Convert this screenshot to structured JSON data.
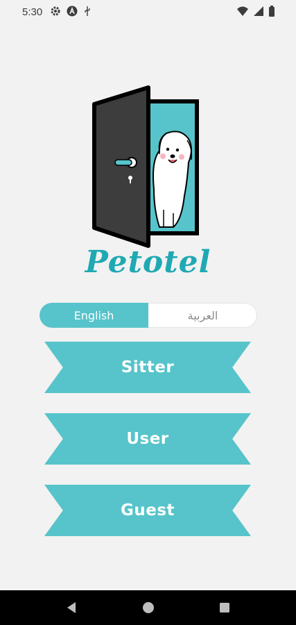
{
  "status_bar": {
    "time": "5:30",
    "left_icons": [
      "gear-icon",
      "a-badge-icon",
      "usb-icon"
    ],
    "right_icons": [
      "wifi-icon",
      "signal-icon",
      "battery-icon"
    ]
  },
  "brand": {
    "name": "Petotel",
    "accent_color": "#56c4ca",
    "text_color": "#1fa9b3"
  },
  "language_toggle": {
    "options": [
      {
        "label": "English",
        "selected": true
      },
      {
        "label": "العربية",
        "selected": false
      }
    ]
  },
  "roles": [
    {
      "label": "Sitter"
    },
    {
      "label": "User"
    },
    {
      "label": "Guest"
    }
  ],
  "nav_bar": {
    "buttons": [
      "back-icon",
      "home-icon",
      "recents-icon"
    ]
  }
}
